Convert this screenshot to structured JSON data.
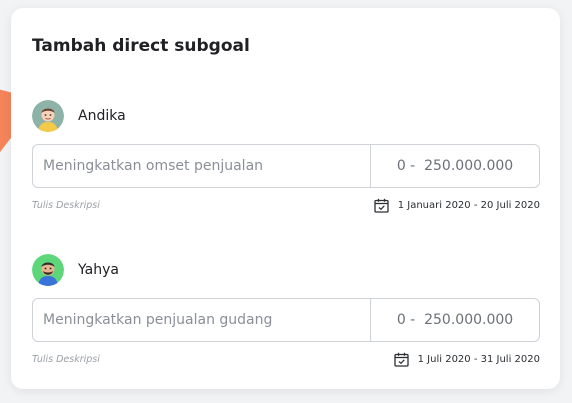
{
  "card": {
    "title": "Tambah direct subgoal"
  },
  "subgoals": [
    {
      "name": "Andika",
      "avatar_icon": "male-avatar-icon",
      "avatar_bg": "#8db3a8",
      "description_placeholder": "Meningkatkan omset penjualan",
      "amount": "0 -  250.000.000",
      "hint": "Tulis Deskripsi",
      "date_range": "1 Januari  2020 - 20 Juli 2020"
    },
    {
      "name": "Yahya",
      "avatar_icon": "male-avatar-icon",
      "avatar_bg": "#5ed67a",
      "description_placeholder": "Meningkatkan penjualan gudang",
      "amount": "0 -  250.000.000",
      "hint": "Tulis Deskripsi",
      "date_range": "1 Juli 2020 - 31 Juli 2020"
    }
  ],
  "colors": {
    "accent_orange": "#f5845a",
    "border": "#cfd3d8"
  }
}
